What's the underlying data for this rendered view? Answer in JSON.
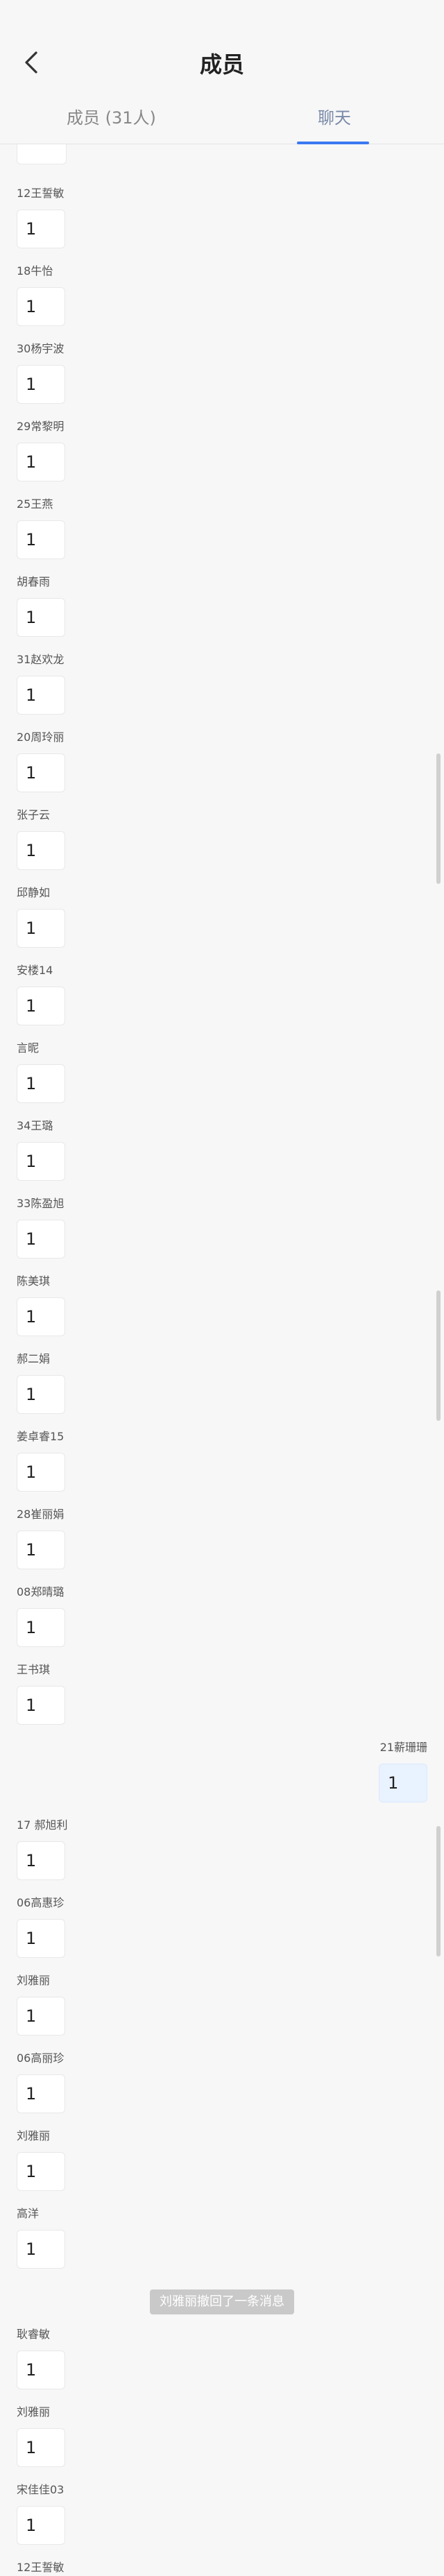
{
  "header": {
    "title": "成员",
    "tabs": [
      {
        "label": "成员 (31人)"
      },
      {
        "label": "聊天"
      }
    ]
  },
  "messages": [
    {
      "name": "12王誓敏",
      "text": "1"
    },
    {
      "name": "18牛怡",
      "text": "1"
    },
    {
      "name": "30杨宇波",
      "text": "1"
    },
    {
      "name": "29常黎明",
      "text": "1"
    },
    {
      "name": "25王燕",
      "text": "1"
    },
    {
      "name": "胡春雨",
      "text": "1"
    },
    {
      "name": "31赵欢龙",
      "text": "1"
    },
    {
      "name": "20周玲丽",
      "text": "1"
    },
    {
      "name": "张子云",
      "text": "1"
    },
    {
      "name": "邱静如",
      "text": "1"
    },
    {
      "name": "安楼14",
      "text": "1"
    },
    {
      "name": "言昵",
      "text": "1"
    },
    {
      "name": "34王璐",
      "text": "1"
    },
    {
      "name": "33陈盈旭",
      "text": "1"
    },
    {
      "name": "陈美琪",
      "text": "1"
    },
    {
      "name": "郝二娟",
      "text": "1"
    },
    {
      "name": "姜卓睿15",
      "text": "1"
    },
    {
      "name": "28崔丽娟",
      "text": "1"
    },
    {
      "name": "08郑晴璐",
      "text": "1"
    },
    {
      "name": "王书琪",
      "text": "1"
    },
    {
      "name": "21薪珊珊",
      "text": "1",
      "self": true
    },
    {
      "name": "17 郝旭利",
      "text": "1"
    },
    {
      "name": "06高惠珍",
      "text": "1"
    },
    {
      "name": "刘雅丽",
      "text": "1"
    },
    {
      "name": "06高丽珍",
      "text": "1"
    },
    {
      "name": "刘雅丽",
      "text": "1"
    },
    {
      "name": "高洋",
      "text": "1"
    },
    {
      "notice": "刘雅丽撤回了一条消息"
    },
    {
      "name": "耿睿敏",
      "text": "1"
    },
    {
      "name": "刘雅丽",
      "text": "1"
    },
    {
      "name": "宋佳佳03",
      "text": "1"
    },
    {
      "name": "12王誓敏",
      "text": ""
    }
  ]
}
